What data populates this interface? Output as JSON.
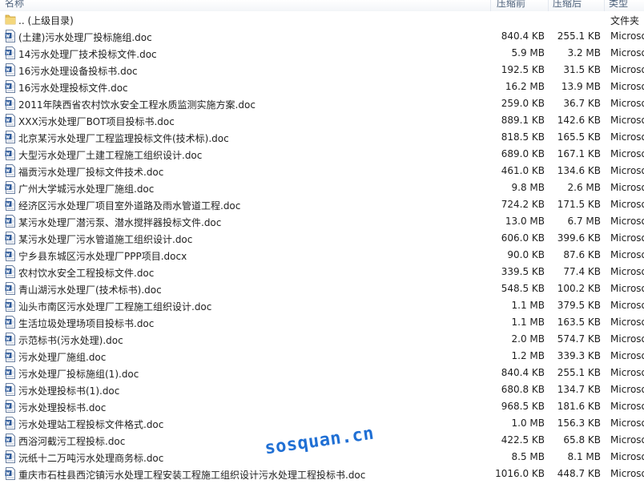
{
  "columns": {
    "name": "名称",
    "compressed": "压缩前",
    "original": "压缩后",
    "type": "类型"
  },
  "parent_row": {
    "name": ".. (上级目录)",
    "type": "文件夹",
    "icon": "folder-icon"
  },
  "files": [
    {
      "name": "(土建)污水处理厂投标施组.doc",
      "compressed": "840.4 KB",
      "original": "255.1 KB",
      "type": "Microso",
      "icon": "word-doc-icon"
    },
    {
      "name": "14污水处理厂技术投标文件.doc",
      "compressed": "5.9 MB",
      "original": "3.2 MB",
      "type": "Microso",
      "icon": "word-doc-icon"
    },
    {
      "name": "16污水处理设备投标书.doc",
      "compressed": "192.5 KB",
      "original": "31.5 KB",
      "type": "Microso",
      "icon": "word-doc-icon"
    },
    {
      "name": "16污水处理投标文件.doc",
      "compressed": "16.2 MB",
      "original": "13.9 MB",
      "type": "Microso",
      "icon": "word-doc-icon"
    },
    {
      "name": "2011年陕西省农村饮水安全工程水质监测实施方案.doc",
      "compressed": "259.0 KB",
      "original": "36.7 KB",
      "type": "Microso",
      "icon": "word-doc-icon"
    },
    {
      "name": "XXX污水处理厂BOT项目投标书.doc",
      "compressed": "889.1 KB",
      "original": "142.6 KB",
      "type": "Microso",
      "icon": "word-doc-icon"
    },
    {
      "name": "北京某污水处理厂工程监理投标文件(技术标).doc",
      "compressed": "818.5 KB",
      "original": "165.5 KB",
      "type": "Microso",
      "icon": "word-doc-icon"
    },
    {
      "name": "大型污水处理厂土建工程施工组织设计.doc",
      "compressed": "689.0 KB",
      "original": "167.1 KB",
      "type": "Microso",
      "icon": "word-doc-icon"
    },
    {
      "name": "福贡污水处理厂投标文件技术.doc",
      "compressed": "461.0 KB",
      "original": "134.6 KB",
      "type": "Microso",
      "icon": "word-doc-icon"
    },
    {
      "name": "广州大学城污水处理厂施组.doc",
      "compressed": "9.8 MB",
      "original": "2.6 MB",
      "type": "Microso",
      "icon": "word-doc-icon"
    },
    {
      "name": "经济区污水处理厂项目室外道路及雨水管道工程.doc",
      "compressed": "724.2 KB",
      "original": "171.5 KB",
      "type": "Microso",
      "icon": "word-doc-icon"
    },
    {
      "name": "某污水处理厂潜污泵、潜水搅拌器投标文件.doc",
      "compressed": "13.0 MB",
      "original": "6.7 MB",
      "type": "Microso",
      "icon": "word-doc-icon"
    },
    {
      "name": "某污水处理厂污水管道施工组织设计.doc",
      "compressed": "606.0 KB",
      "original": "399.6 KB",
      "type": "Microso",
      "icon": "word-doc-icon"
    },
    {
      "name": "宁乡县东城区污水处理厂PPP项目.docx",
      "compressed": "90.0 KB",
      "original": "87.6 KB",
      "type": "Microso",
      "icon": "word-doc-icon"
    },
    {
      "name": "农村饮水安全工程投标文件.doc",
      "compressed": "339.5 KB",
      "original": "77.4 KB",
      "type": "Microso",
      "icon": "word-doc-icon"
    },
    {
      "name": "青山湖污水处理厂(技术标书).doc",
      "compressed": "548.5 KB",
      "original": "100.2 KB",
      "type": "Microso",
      "icon": "word-doc-icon"
    },
    {
      "name": "汕头市南区污水处理厂工程施工组织设计.doc",
      "compressed": "1.1 MB",
      "original": "379.5 KB",
      "type": "Microso",
      "icon": "word-doc-icon"
    },
    {
      "name": "生活垃圾处理场项目投标书.doc",
      "compressed": "1.1 MB",
      "original": "163.5 KB",
      "type": "Microso",
      "icon": "word-doc-icon"
    },
    {
      "name": "示范标书(污水处理).doc",
      "compressed": "2.0 MB",
      "original": "574.7 KB",
      "type": "Microso",
      "icon": "word-doc-icon"
    },
    {
      "name": "污水处理厂施组.doc",
      "compressed": "1.2 MB",
      "original": "339.3 KB",
      "type": "Microso",
      "icon": "word-doc-icon"
    },
    {
      "name": "污水处理厂投标施组(1).doc",
      "compressed": "840.4 KB",
      "original": "255.1 KB",
      "type": "Microso",
      "icon": "word-doc-icon"
    },
    {
      "name": "污水处理投标书(1).doc",
      "compressed": "680.8 KB",
      "original": "134.7 KB",
      "type": "Microso",
      "icon": "word-doc-icon"
    },
    {
      "name": "污水处理投标书.doc",
      "compressed": "968.5 KB",
      "original": "181.6 KB",
      "type": "Microso",
      "icon": "word-doc-icon"
    },
    {
      "name": "污水处理站工程投标文件格式.doc",
      "compressed": "1.0 MB",
      "original": "156.3 KB",
      "type": "Microso",
      "icon": "word-doc-icon"
    },
    {
      "name": "西浴河截污工程投标.doc",
      "compressed": "422.5 KB",
      "original": "65.8 KB",
      "type": "Microso",
      "icon": "word-doc-icon"
    },
    {
      "name": "沅纸十二万吨污水处理商务标.doc",
      "compressed": "8.5 MB",
      "original": "8.1 MB",
      "type": "Microso",
      "icon": "word-doc-icon"
    },
    {
      "name": "重庆市石柱县西沱镇污水处理工程安装工程施工组织设计污水处理工程投标书.doc",
      "compressed": "1016.0 KB",
      "original": "448.7 KB",
      "type": "Microso",
      "icon": "word-doc-icon"
    }
  ],
  "watermark": "sosquan.cn"
}
